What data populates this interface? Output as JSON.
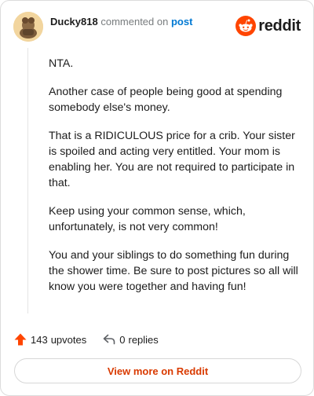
{
  "comment": {
    "username": "Ducky818",
    "action": "commented on",
    "post_link": "post",
    "paragraphs": [
      "NTA.",
      "Another case of people being good at spending somebody else's money.",
      "That is a RIDICULOUS price for a crib. Your sister is spoiled and acting very entitled. Your mom is enabling her. You are not required to participate in that.",
      "Keep using your common sense, which, unfortunately, is not very common!",
      "You and your siblings to do something fun during the shower time. Be sure to post pictures so all will know you were together and having fun!"
    ]
  },
  "brand": {
    "name": "reddit",
    "color": "#ff4500"
  },
  "footer": {
    "upvotes_count": "143",
    "upvotes_label": "upvotes",
    "replies_count": "0",
    "replies_label": "replies"
  },
  "view_more_label": "View more on Reddit",
  "colors": {
    "accent": "#d93a00",
    "link": "#0079d3",
    "muted": "#787c7e"
  },
  "icons": [
    "avatar",
    "reddit-logo-icon",
    "upvote-arrow-icon",
    "reply-arrow-icon"
  ]
}
